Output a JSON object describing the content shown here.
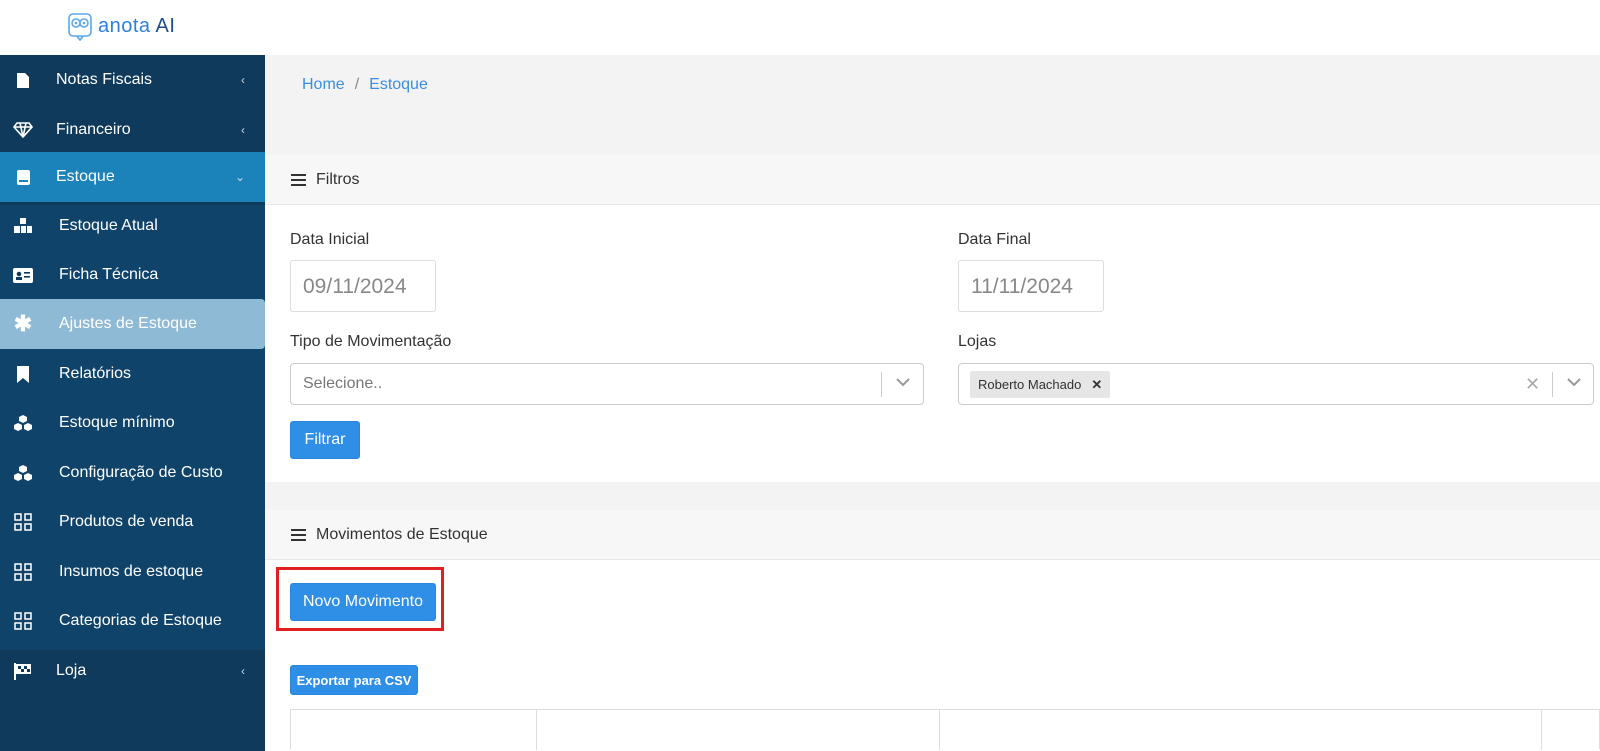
{
  "header": {
    "logo_text_main": "anota",
    "logo_text_ai": "AI"
  },
  "sidebar": {
    "items": [
      {
        "label": "Notas Fiscais",
        "icon": "file-icon",
        "chevron": "‹"
      },
      {
        "label": "Financeiro",
        "icon": "diamond-icon",
        "chevron": "‹"
      },
      {
        "label": "Estoque",
        "icon": "book-icon",
        "chevron": "⌄"
      },
      {
        "label": "Estoque Atual",
        "icon": "boxes-icon"
      },
      {
        "label": "Ficha Técnica",
        "icon": "id-card-icon"
      },
      {
        "label": "Ajustes de Estoque",
        "icon": "asterisk-icon"
      },
      {
        "label": "Relatórios",
        "icon": "bookmark-icon"
      },
      {
        "label": "Estoque mínimo",
        "icon": "cubes-icon"
      },
      {
        "label": "Configuração de Custo",
        "icon": "cubes-icon"
      },
      {
        "label": "Produtos de venda",
        "icon": "grid-icon"
      },
      {
        "label": "Insumos de estoque",
        "icon": "grid-icon"
      },
      {
        "label": "Categorias de Estoque",
        "icon": "grid-icon"
      },
      {
        "label": "Loja",
        "icon": "flag-icon",
        "chevron": "‹"
      }
    ]
  },
  "breadcrumb": {
    "home": "Home",
    "sep": "/",
    "current": "Estoque"
  },
  "filters": {
    "title": "Filtros",
    "data_inicial_label": "Data Inicial",
    "data_inicial_value": "09/11/2024",
    "data_final_label": "Data Final",
    "data_final_value": "11/11/2024",
    "tipo_label": "Tipo de Movimentação",
    "tipo_placeholder": "Selecione..",
    "lojas_label": "Lojas",
    "lojas_selected": "Roberto Machado",
    "filter_button": "Filtrar"
  },
  "movements": {
    "title": "Movimentos de Estoque",
    "new_button": "Novo Movimento",
    "export_button": "Exportar para CSV"
  },
  "colors": {
    "sidebar_bg": "#0f3a5c",
    "active_parent": "#1c82ba",
    "active_item": "#8fbad6",
    "primary_button": "#2f8ee6",
    "highlight": "#e02020"
  }
}
